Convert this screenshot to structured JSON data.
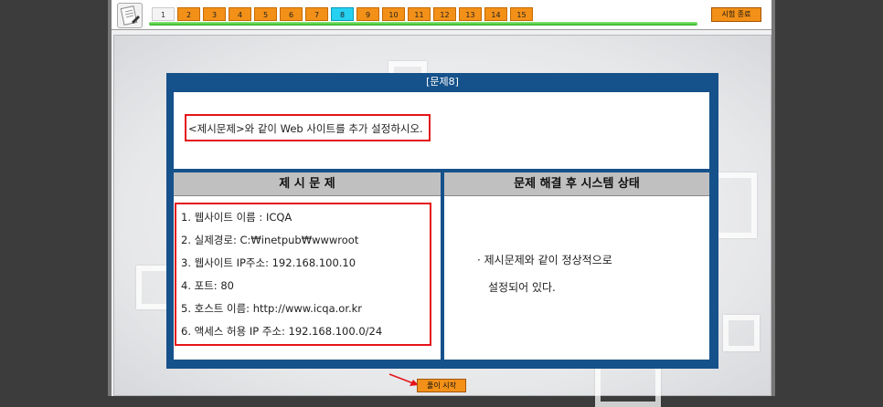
{
  "toolbar": {
    "icon": "exam-sheet-icon",
    "question_numbers": [
      "1",
      "2",
      "3",
      "4",
      "5",
      "6",
      "7",
      "8",
      "9",
      "10",
      "11",
      "12",
      "13",
      "14",
      "15"
    ],
    "current_question": "8",
    "end_exam_label": "시험 종료"
  },
  "question": {
    "title": "[문제8]",
    "instruction": "<제시문제>와 같이 Web 사이트를 추가 설정하시오."
  },
  "left_column": {
    "header": "제 시 문 제",
    "requirements": [
      "1. 웹사이트 이름 : ICQA",
      "2. 실제경로: C:₩inetpub₩wwwroot",
      "3. 웹사이트 IP주소: 192.168.100.10",
      "4. 포트: 80",
      "5. 호스트 이름: http://www.icqa.or.kr",
      "6. 액세스 허용 IP 주소: 192.168.100.0/24"
    ]
  },
  "right_column": {
    "header": "문제 해결 후 시스템 상태",
    "status_line1": "· 제시문제와 같이 정상적으로",
    "status_line2": "설정되어 있다."
  },
  "footer": {
    "start_label": "풀이 시작"
  },
  "colors": {
    "panel_blue": "#15518a",
    "orange": "#f29018",
    "highlight_red": "#e4141a",
    "current_cyan": "#25d0f0"
  }
}
